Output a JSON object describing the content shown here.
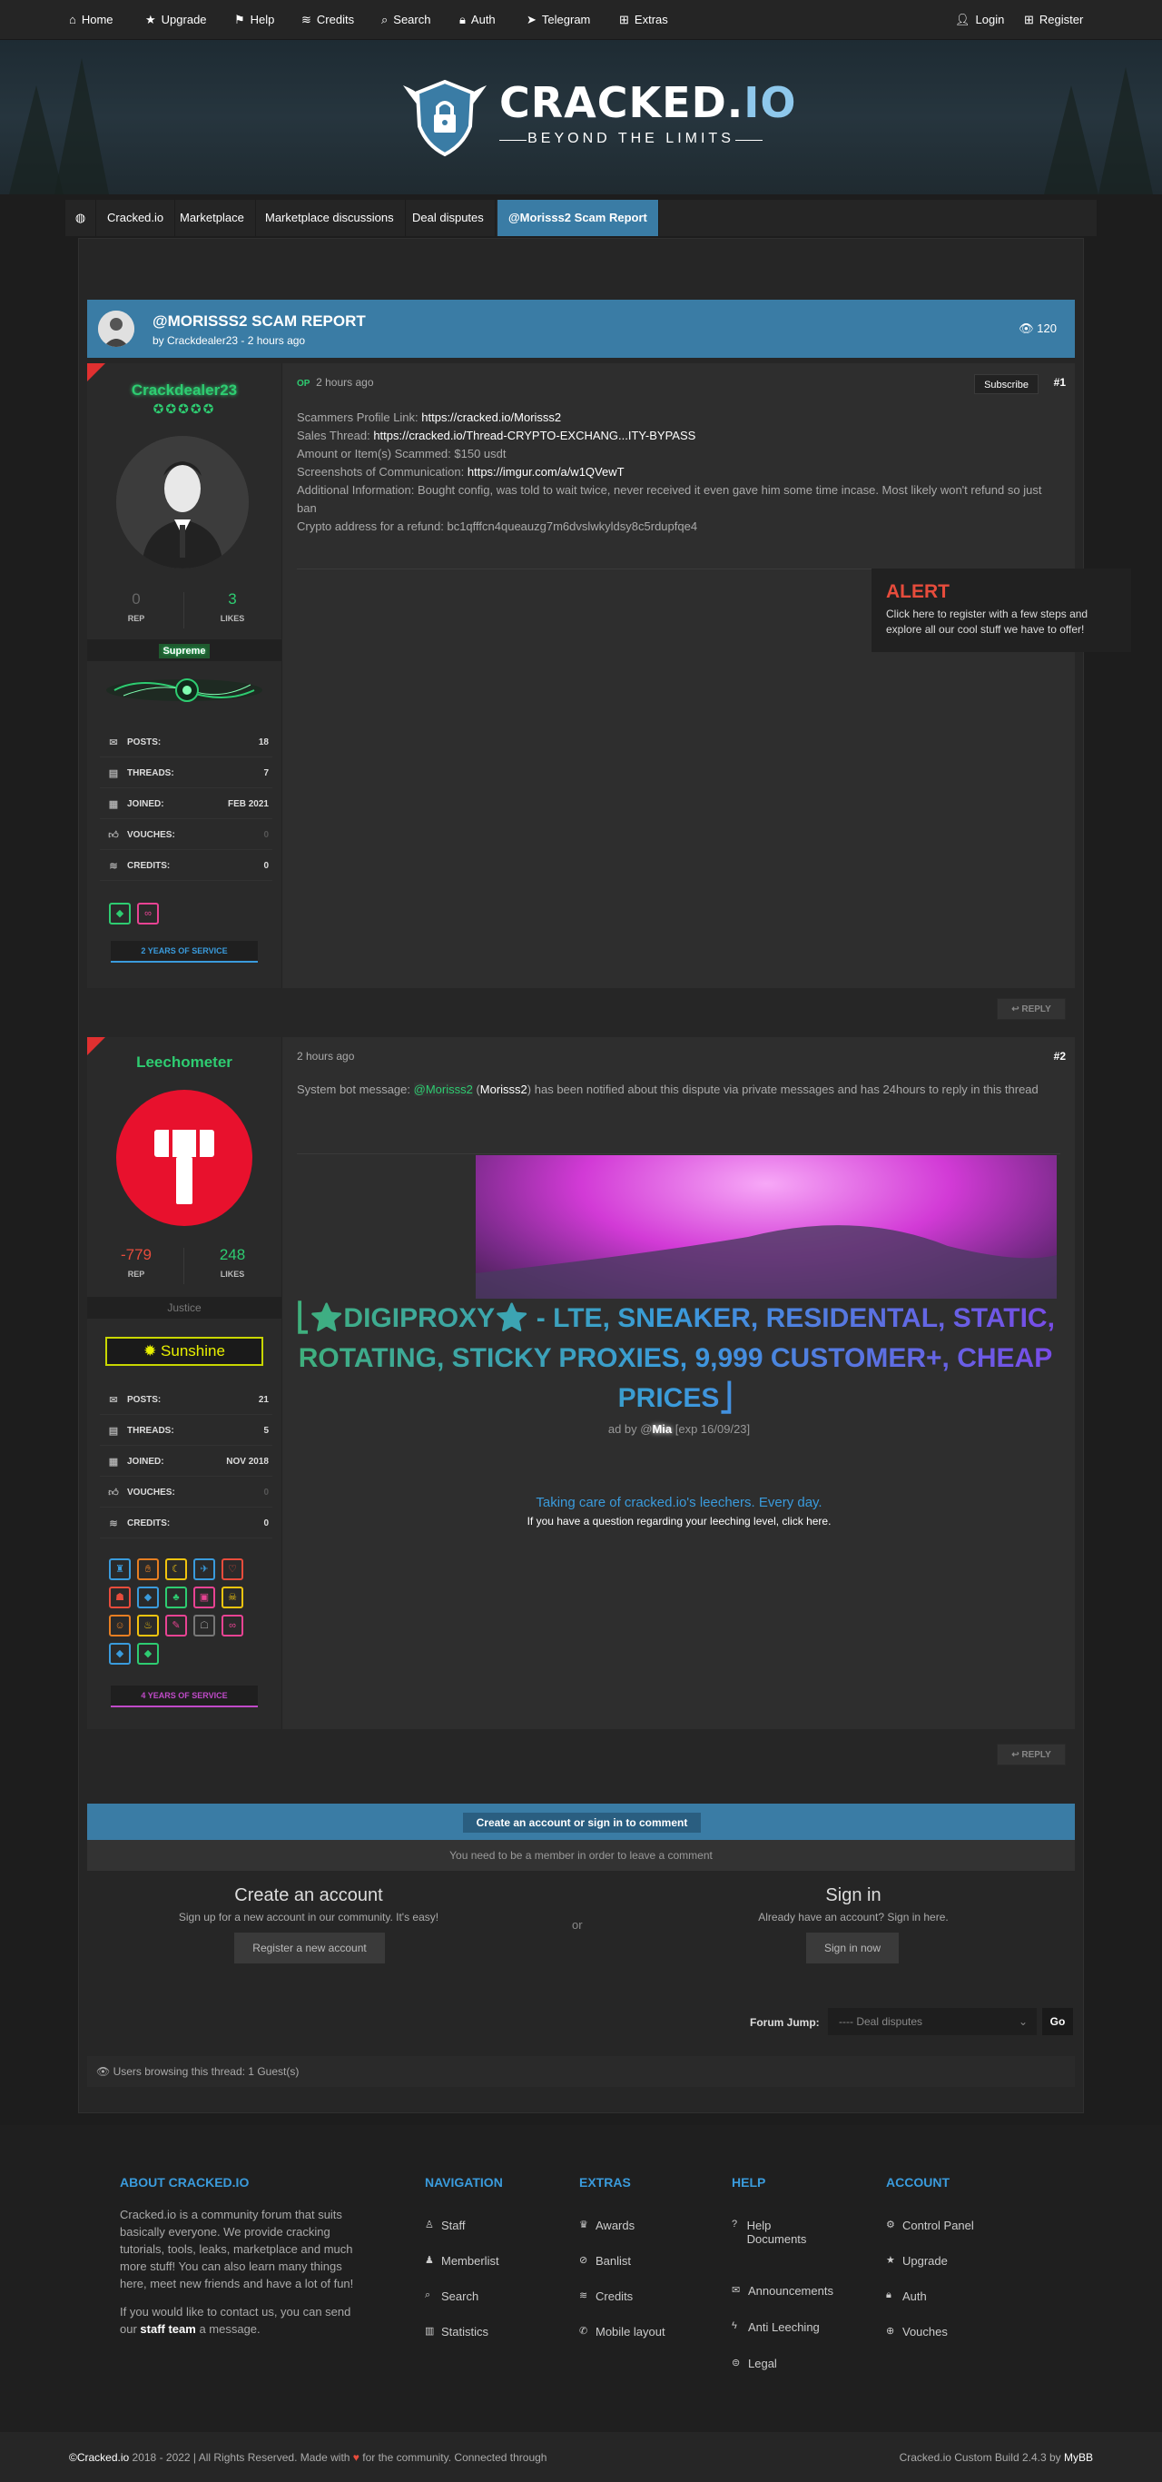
{
  "topnav": {
    "items": [
      {
        "label": "Home",
        "icon": "home-icon"
      },
      {
        "label": "Upgrade",
        "icon": "star-icon"
      },
      {
        "label": "Help",
        "icon": "flag-icon"
      },
      {
        "label": "Credits",
        "icon": "coins-icon"
      },
      {
        "label": "Search",
        "icon": "search-icon"
      },
      {
        "label": "Auth",
        "icon": "lock-icon"
      },
      {
        "label": "Telegram",
        "icon": "telegram-icon"
      },
      {
        "label": "Extras",
        "icon": "plus-icon"
      }
    ],
    "login": "Login",
    "register": "Register"
  },
  "header": {
    "logo_main": "CRACKED.",
    "logo_io": "IO",
    "tagline": "BEYOND THE LIMITS"
  },
  "breadcrumb": [
    "Cracked.io",
    "Marketplace",
    "Marketplace discussions",
    "Deal disputes",
    "@Morisss2 Scam Report"
  ],
  "thread": {
    "title": "@MORISSS2 SCAM REPORT",
    "byline": "by Crackdealer23 - 2 hours ago",
    "views": "120"
  },
  "post1": {
    "username": "Crackdealer23",
    "stars": "✪✪✪✪✪",
    "rep": "0",
    "likes": "3",
    "rep_label": "REP",
    "likes_label": "LIKES",
    "group": "Supreme",
    "info": [
      {
        "label": "POSTS:",
        "value": "18"
      },
      {
        "label": "THREADS:",
        "value": "7"
      },
      {
        "label": "JOINED:",
        "value": "FEB 2021"
      },
      {
        "label": "VOUCHES:",
        "value": "0"
      },
      {
        "label": "CREDITS:",
        "value": "0"
      }
    ],
    "years": "2 YEARS OF SERVICE",
    "op": "OP",
    "time": "2 hours ago",
    "subscribe": "Subscribe",
    "num": "#1",
    "lines": [
      {
        "label": "Scammers Profile Link: ",
        "value": "https://cracked.io/Morisss2"
      },
      {
        "label": "Sales Thread: ",
        "value": "https://cracked.io/Thread-CRYPTO-EXCHANG...ITY-BYPASS"
      },
      {
        "label": "Amount or Item(s) Scammed: $150 usdt",
        "value": ""
      },
      {
        "label": "Screenshots of Communication: ",
        "value": "https://imgur.com/a/w1QVewT"
      },
      {
        "label": "Additional Information: Bought config, was told to wait twice, never received it even gave him some time incase. Most likely won't refund so just ban",
        "value": ""
      },
      {
        "label": "Crypto address for a refund: bc1qfffcn4queauzg7m6dvslwkyldsy8c5rdupfqe4",
        "value": ""
      }
    ],
    "reply": "REPLY"
  },
  "alert": {
    "title": "ALERT",
    "text": "Click here to register with a few steps and explore all our cool stuff we have to offer!"
  },
  "post2": {
    "username": "Leechometer",
    "rep": "-779",
    "likes": "248",
    "rep_label": "REP",
    "likes_label": "LIKES",
    "group": "Justice",
    "sunshine": "Sunshine",
    "info": [
      {
        "label": "POSTS:",
        "value": "21"
      },
      {
        "label": "THREADS:",
        "value": "5"
      },
      {
        "label": "JOINED:",
        "value": "NOV 2018"
      },
      {
        "label": "VOUCHES:",
        "value": "0"
      },
      {
        "label": "CREDITS:",
        "value": "0"
      }
    ],
    "years": "4 YEARS OF SERVICE",
    "time": "2 hours ago",
    "num": "#2",
    "msg_prefix": "System bot message: ",
    "msg_user": "@Morisss2",
    "msg_paren": "Morisss2",
    "msg_rest": " has been notified about this dispute via private messages and has 24hours to reply in this thread",
    "ad_title": "⎣⭐DIGIPROXY⭐ - LTE, SNEAKER, RESIDENTAL, STATIC, ROTATING, STICKY PROXIES, 9,999 CUSTOMER+, CHEAP PRICES⎦",
    "ad_by_prefix": "ad by @",
    "ad_by_user": "Mia",
    "ad_exp": " [exp 16/09/23]",
    "leech_line": "Taking care of cracked.io's leechers. Every day.",
    "leech_sub": "If you have a question regarding your leeching level, click here.",
    "reply": "REPLY"
  },
  "comment": {
    "bar_button": "Create an account or sign in to comment",
    "member_note": "You need to be a member in order to leave a comment",
    "create_title": "Create an account",
    "create_sub": "Sign up for a new account in our community. It's easy!",
    "create_btn": "Register a new account",
    "or": "or",
    "signin_title": "Sign in",
    "signin_sub": "Already have an account? Sign in here.",
    "signin_btn": "Sign in now"
  },
  "forum_jump": {
    "label": "Forum Jump:",
    "selected": "---- Deal disputes",
    "go": "Go"
  },
  "browsing": "Users browsing this thread: 1 Guest(s)",
  "footer": {
    "about_title": "ABOUT CRACKED.IO",
    "about_p1": "Cracked.io is a community forum that suits basically everyone. We provide cracking tutorials, tools, leaks, marketplace and much more stuff! You can also learn many things here, meet new friends and have a lot of fun!",
    "about_p2_a": "If you would like to contact us, you can send our ",
    "about_p2_link": "staff team",
    "about_p2_b": " a message.",
    "nav_title": "NAVIGATION",
    "nav": [
      "Staff",
      "Memberlist",
      "Search",
      "Statistics"
    ],
    "extras_title": "EXTRAS",
    "extras": [
      "Awards",
      "Banlist",
      "Credits",
      "Mobile layout"
    ],
    "help_title": "HELP",
    "help": [
      "Help Documents",
      "Announcements",
      "Anti Leeching",
      "Legal"
    ],
    "account_title": "ACCOUNT",
    "account": [
      "Control Panel",
      "Upgrade",
      "Auth",
      "Vouches"
    ],
    "copy_brand": "©Cracked.io",
    "copy_text": " 2018 - 2022 | All Rights Reserved. Made with ",
    "copy_text2": " for the community. Connected through",
    "build_text": "Cracked.io Custom Build 2.4.3 by ",
    "build_link": "MyBB"
  },
  "colors": {
    "accent": "#3a7ca5",
    "green": "#2ecc71",
    "red": "#e03030",
    "alert": "#e74c3c"
  }
}
